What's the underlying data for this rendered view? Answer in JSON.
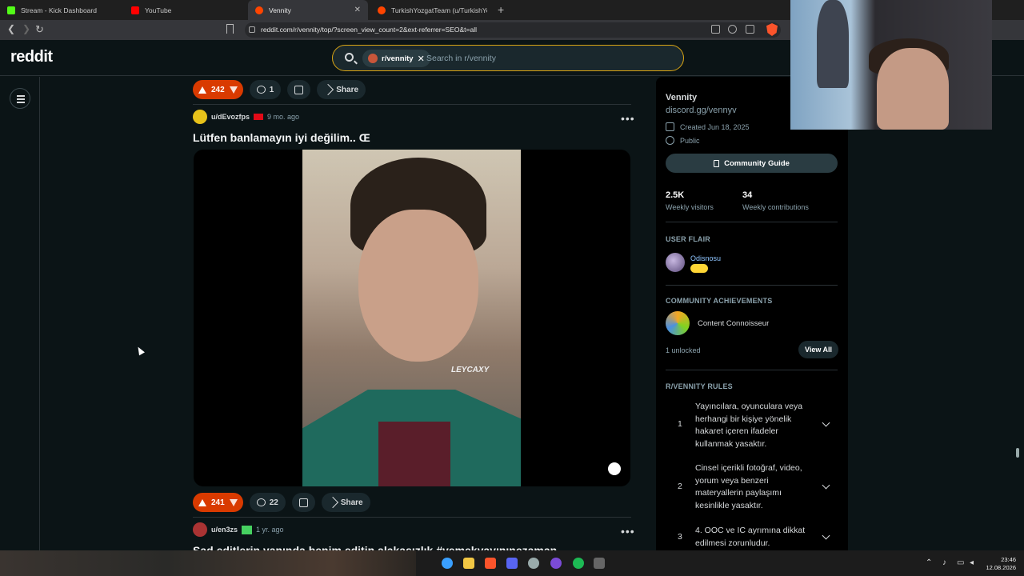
{
  "browser": {
    "tabs": [
      {
        "title": "Stream - Kick Dashboard",
        "color": "#53fc18"
      },
      {
        "title": "YouTube",
        "color": "#ff0000"
      },
      {
        "title": "Vennity",
        "color": "#ff4500"
      },
      {
        "title": "TurkishYozgatTeam (u/TurkishYozgat",
        "color": "#ff4500"
      }
    ],
    "url": "reddit.com/r/vennity/top/?screen_view_count=2&ext-referrer=SEO&t=all"
  },
  "header": {
    "logo": "reddit",
    "search_chip": "r/vennity",
    "search_placeholder": "Search in r/vennity"
  },
  "posts": [
    {
      "votes": "242",
      "comments": "1",
      "share_label": "Share"
    },
    {
      "user": "u/dEvozfps",
      "time": "9 mo. ago",
      "title": "Lütfen banlamayın iyi değilim.. Œ",
      "watermark": "LEYCAXY",
      "votes": "241",
      "comments": "22",
      "share_label": "Share"
    },
    {
      "user": "u/en3zs",
      "time": "1 yr. ago",
      "title": "Sad editlerin yanında benim editin alakasızlık #yemekyayınınezaman"
    }
  ],
  "sidebar": {
    "name": "Vennity",
    "link": "discord.gg/vennyv",
    "created": "Created Jun 18, 2025",
    "visibility": "Public",
    "guide_button": "Community Guide",
    "stats": [
      {
        "value": "2.5K",
        "label": "Weekly visitors"
      },
      {
        "value": "34",
        "label": "Weekly contributions"
      }
    ],
    "user_flair_heading": "USER FLAIR",
    "flair_name": "Odisnosu",
    "achievements_heading": "COMMUNITY ACHIEVEMENTS",
    "achievement": "Content Connoisseur",
    "unlocked": "1 unlocked",
    "view_all": "View All",
    "rules_heading": "R/VENNITY RULES",
    "rules": [
      {
        "num": "1",
        "text": "Yayıncılara, oyunculara veya herhangi bir kişiye yönelik hakaret içeren ifadeler kullanmak yasaktır."
      },
      {
        "num": "2",
        "text": "Cinsel içerikli fotoğraf, video, yorum veya benzeri materyallerin paylaşımı kesinlikle yasaktır."
      },
      {
        "num": "3",
        "text": "4. OOC ve IC ayrımına dikkat edilmesi zorunludur."
      }
    ]
  },
  "taskbar": {
    "time": "23:46",
    "date": "12.08.2026"
  }
}
